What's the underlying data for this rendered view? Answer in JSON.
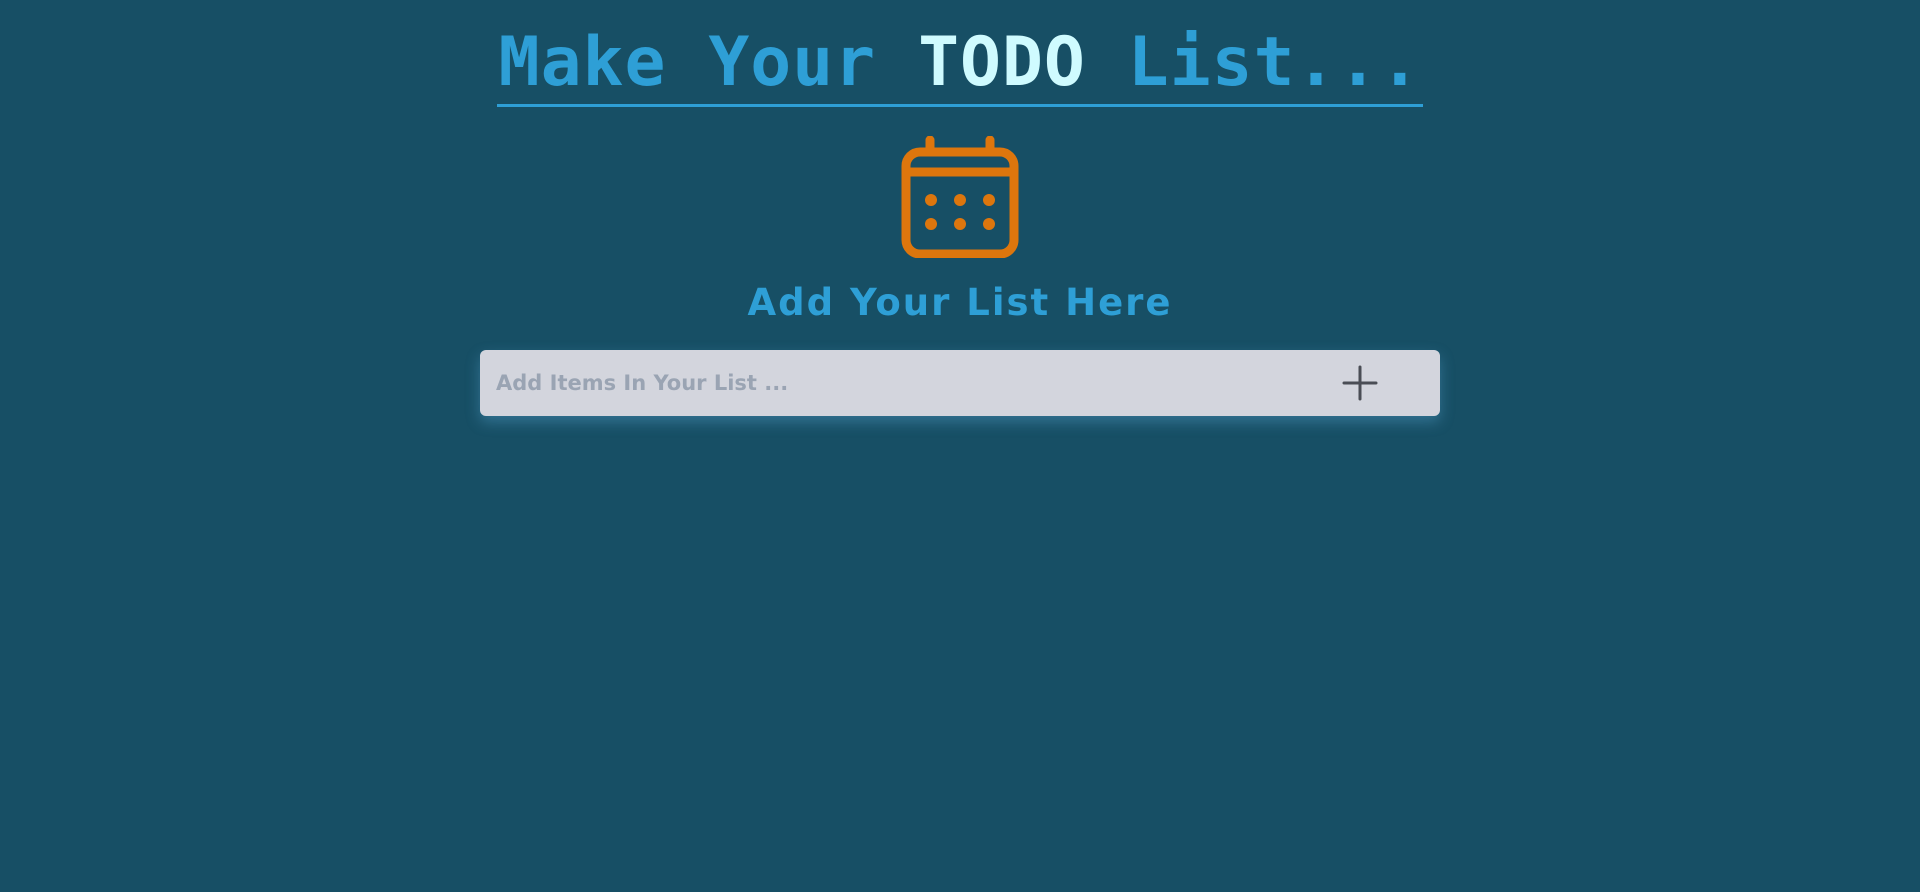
{
  "header": {
    "title_part1": "Make Your ",
    "title_highlight": "TODO",
    "title_part2": " List..."
  },
  "icons": {
    "main_icon": "calendar-icon",
    "add_icon": "plus-icon"
  },
  "main": {
    "subtitle": "Add Your List Here"
  },
  "form": {
    "input_value": "",
    "input_placeholder": "Add Items In Your List ..."
  },
  "colors": {
    "background": "#174f65",
    "title_accent": "#2e9fd6",
    "title_highlight": "#cffbff",
    "icon_orange": "#dd760d",
    "input_background": "#d3d5dd"
  }
}
